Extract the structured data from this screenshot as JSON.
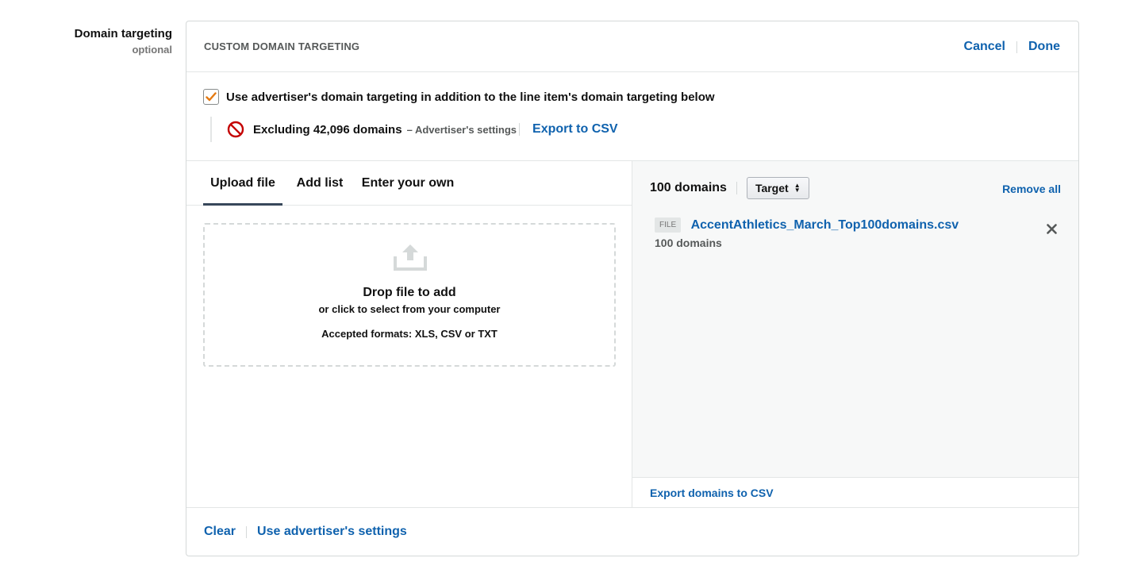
{
  "side": {
    "title": "Domain targeting",
    "subtitle": "optional"
  },
  "header": {
    "title": "CUSTOM DOMAIN TARGETING",
    "cancel_label": "Cancel",
    "done_label": "Done"
  },
  "advertiser": {
    "checkbox_label": "Use advertiser's domain targeting in addition to the line item's domain targeting below",
    "checked": true,
    "excluding_text": "Excluding 42,096 domains",
    "excluding_sub": "– Advertiser's settings",
    "export_label": "Export to CSV"
  },
  "tabs": [
    {
      "label": "Upload file",
      "active": true
    },
    {
      "label": "Add list",
      "active": false
    },
    {
      "label": "Enter your own",
      "active": false
    }
  ],
  "dropzone": {
    "title": "Drop file to add",
    "subtitle": "or click to select from your computer",
    "formats": "Accepted formats: XLS, CSV or TXT"
  },
  "right": {
    "count_label": "100 domains",
    "select_value": "Target",
    "remove_all_label": "Remove all",
    "file": {
      "badge": "FILE",
      "name": "AccentAthletics_March_Top100domains.csv",
      "count": "100 domains"
    },
    "export_label": "Export domains to CSV"
  },
  "footer": {
    "clear_label": "Clear",
    "use_settings_label": "Use advertiser's settings"
  },
  "colors": {
    "link": "#0f62ae",
    "checkbox_check": "#e47911",
    "exclude_icon": "#c40000",
    "tab_active": "#37475a"
  }
}
